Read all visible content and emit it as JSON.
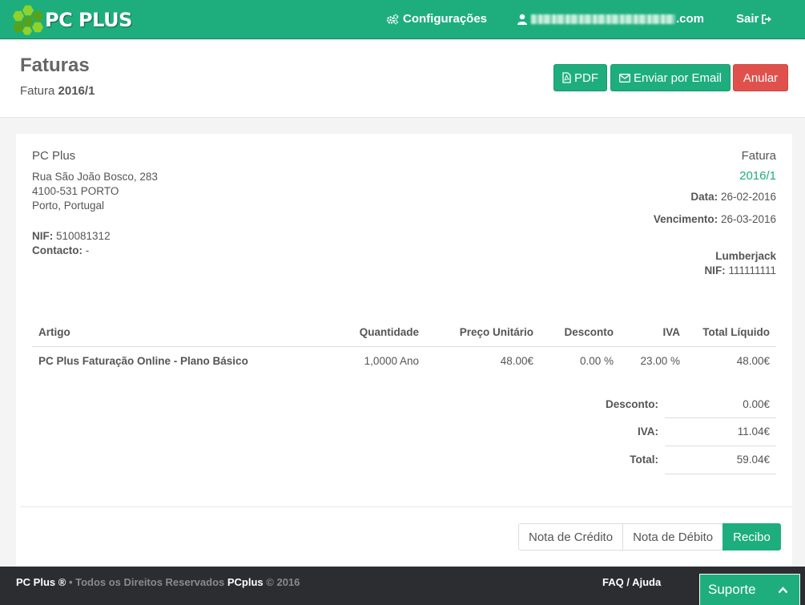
{
  "navbar": {
    "brand": "PC PLUS",
    "config_label": "Configurações",
    "user_suffix": ".com",
    "logout_label": "Sair"
  },
  "header": {
    "title": "Faturas",
    "subtitle_prefix": "Fatura ",
    "subtitle_number": "2016/1",
    "pdf_label": "PDF",
    "email_label": "Enviar por Email",
    "cancel_label": "Anular"
  },
  "issuer": {
    "name": "PC Plus",
    "address_line1": "Rua São João Bosco, 283",
    "address_line2": "4100-531 PORTO",
    "address_line3": "Porto, Portugal",
    "nif_label": "NIF:",
    "nif": " 510081312",
    "contact_label": "Contacto:",
    "contact": " -"
  },
  "invoice": {
    "type": "Fatura",
    "number": "2016/1",
    "date_label": "Data:",
    "date": " 26-02-2016",
    "due_label": "Vencimento:",
    "due": " 26-03-2016"
  },
  "client": {
    "name": "Lumberjack",
    "nif_label": "NIF:",
    "nif": " 111111111"
  },
  "table": {
    "columns": [
      "Artigo",
      "Quantidade",
      "Preço Unitário",
      "Desconto",
      "IVA",
      "Total Líquido"
    ],
    "rows": [
      [
        "PC Plus Faturação Online - Plano Básico",
        "1,0000 Ano",
        "48.00€",
        "0.00 %",
        "23.00 %",
        "48.00€"
      ]
    ]
  },
  "totals": {
    "discount_label": "Desconto:",
    "discount": "0.00€",
    "vat_label": "IVA:",
    "vat": "11.04€",
    "total_label": "Total:",
    "total": "59.04€"
  },
  "actions": {
    "credit_note": "Nota de Crédito",
    "debit_note": "Nota de Débito",
    "receipt": "Recibo"
  },
  "footer": {
    "brand": "PC Plus ®",
    "rights": " • Todos os Direitos Reservados ",
    "brand2": "PCplus",
    "year": " © 2016",
    "faq": "FAQ / Ajuda",
    "support": "Suporte"
  },
  "colors": {
    "primary": "#1eae7d",
    "danger": "#e0514c",
    "footer_bg": "#2b2d31"
  }
}
